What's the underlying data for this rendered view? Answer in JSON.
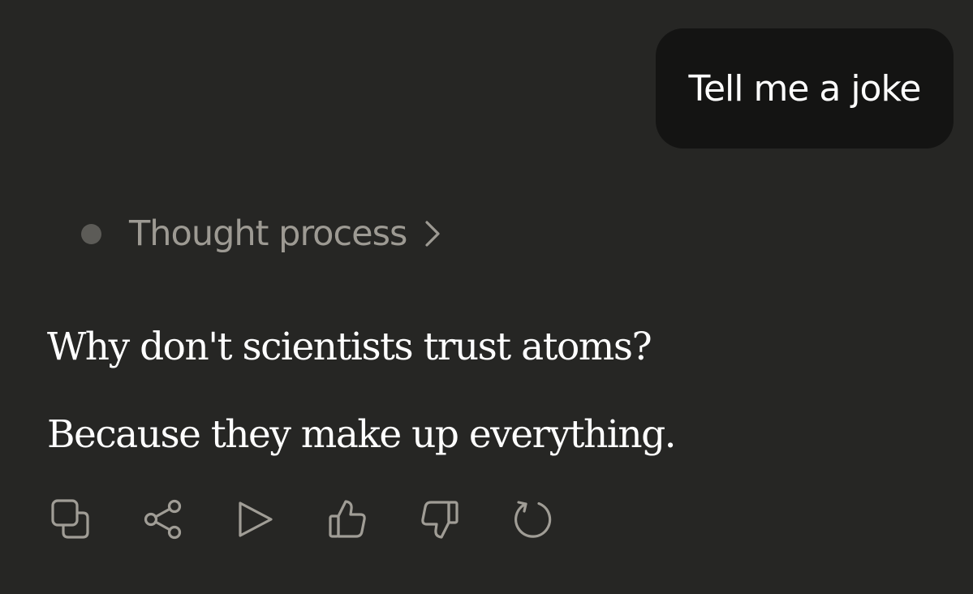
{
  "user_message": {
    "text": "Tell me a joke"
  },
  "thought_process": {
    "label": "Thought process",
    "icon": "chevron-right-icon"
  },
  "assistant_message": {
    "lines": [
      "Why don't scientists trust atoms?",
      "Because they make up everything."
    ]
  },
  "action_bar": {
    "icons": [
      "copy-icon",
      "share-icon",
      "play-icon",
      "thumbs-up-icon",
      "thumbs-down-icon",
      "retry-icon"
    ]
  },
  "colors": {
    "background": "#262624",
    "user_bubble": "#141413",
    "text_primary": "#ffffff",
    "text_muted": "#9d9a93",
    "icon": "#a09d96",
    "dot": "#5c5b57"
  }
}
